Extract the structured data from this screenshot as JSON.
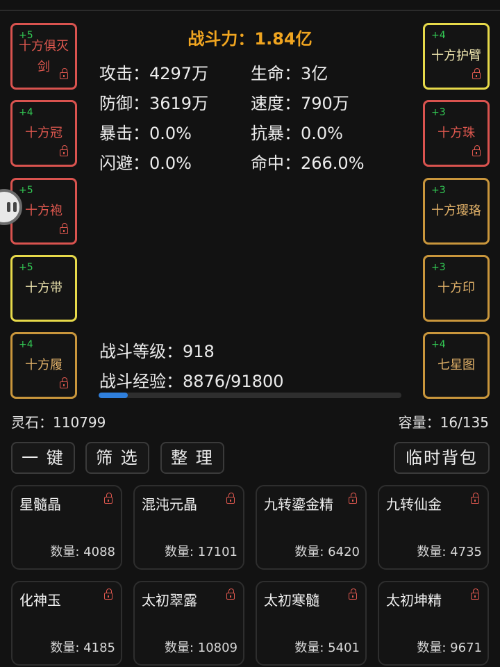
{
  "combat_power": {
    "label": "战斗力：",
    "value": "1.84亿"
  },
  "left_slots": [
    {
      "plus": "+5",
      "name": "十方俱灭剑",
      "quality": "red",
      "locked": true
    },
    {
      "plus": "+4",
      "name": "十方冠",
      "quality": "red",
      "locked": true
    },
    {
      "plus": "+5",
      "name": "十方袍",
      "quality": "red",
      "locked": true
    },
    {
      "plus": "+5",
      "name": "十方带",
      "quality": "yellow",
      "locked": false
    },
    {
      "plus": "+4",
      "name": "十方履",
      "quality": "orange",
      "locked": true
    }
  ],
  "right_slots": [
    {
      "plus": "+4",
      "name": "十方护臂",
      "quality": "yellow",
      "locked": true
    },
    {
      "plus": "+3",
      "name": "十方珠",
      "quality": "red",
      "locked": true
    },
    {
      "plus": "+3",
      "name": "十方璎珞",
      "quality": "orange",
      "locked": false
    },
    {
      "plus": "+3",
      "name": "十方印",
      "quality": "orange",
      "locked": false
    },
    {
      "plus": "+4",
      "name": "七星图",
      "quality": "orange",
      "locked": false
    }
  ],
  "stats": {
    "attack": "攻击：4297万",
    "hp": "生命：3亿",
    "defense": "防御：3619万",
    "speed": "速度：790万",
    "crit": "暴击：0.0%",
    "anti_crit": "抗暴：0.0%",
    "dodge": "闪避：0.0%",
    "hit": "命中：266.0%"
  },
  "battle": {
    "level": "战斗等级：918",
    "exp": "战斗经验：8876/91800",
    "exp_progress": 0.0967
  },
  "spirit_stones": "灵石：110799",
  "capacity": "容量：16/135",
  "buttons": {
    "one_key": "一 键",
    "filter": "筛 选",
    "sort": "整 理",
    "temp_bag": "临时背包"
  },
  "items": [
    {
      "name": "星髓晶",
      "qty": "数量: 4088"
    },
    {
      "name": "混沌元晶",
      "qty": "数量: 17101"
    },
    {
      "name": "九转鎏金精",
      "qty": "数量: 6420"
    },
    {
      "name": "九转仙金",
      "qty": "数量: 4735"
    },
    {
      "name": "化神玉",
      "qty": "数量: 4185"
    },
    {
      "name": "太初翠露",
      "qty": "数量: 10809"
    },
    {
      "name": "太初寒髓",
      "qty": "数量: 5401"
    },
    {
      "name": "太初坤精",
      "qty": "数量: 9671"
    }
  ],
  "colors": {
    "power": "#f0a520",
    "red_quality": "#d9534f",
    "yellow_quality": "#e6d94a",
    "orange_quality": "#c9963c",
    "enhance_green": "#33cc55",
    "exp_bar": "#2f7fdc"
  }
}
